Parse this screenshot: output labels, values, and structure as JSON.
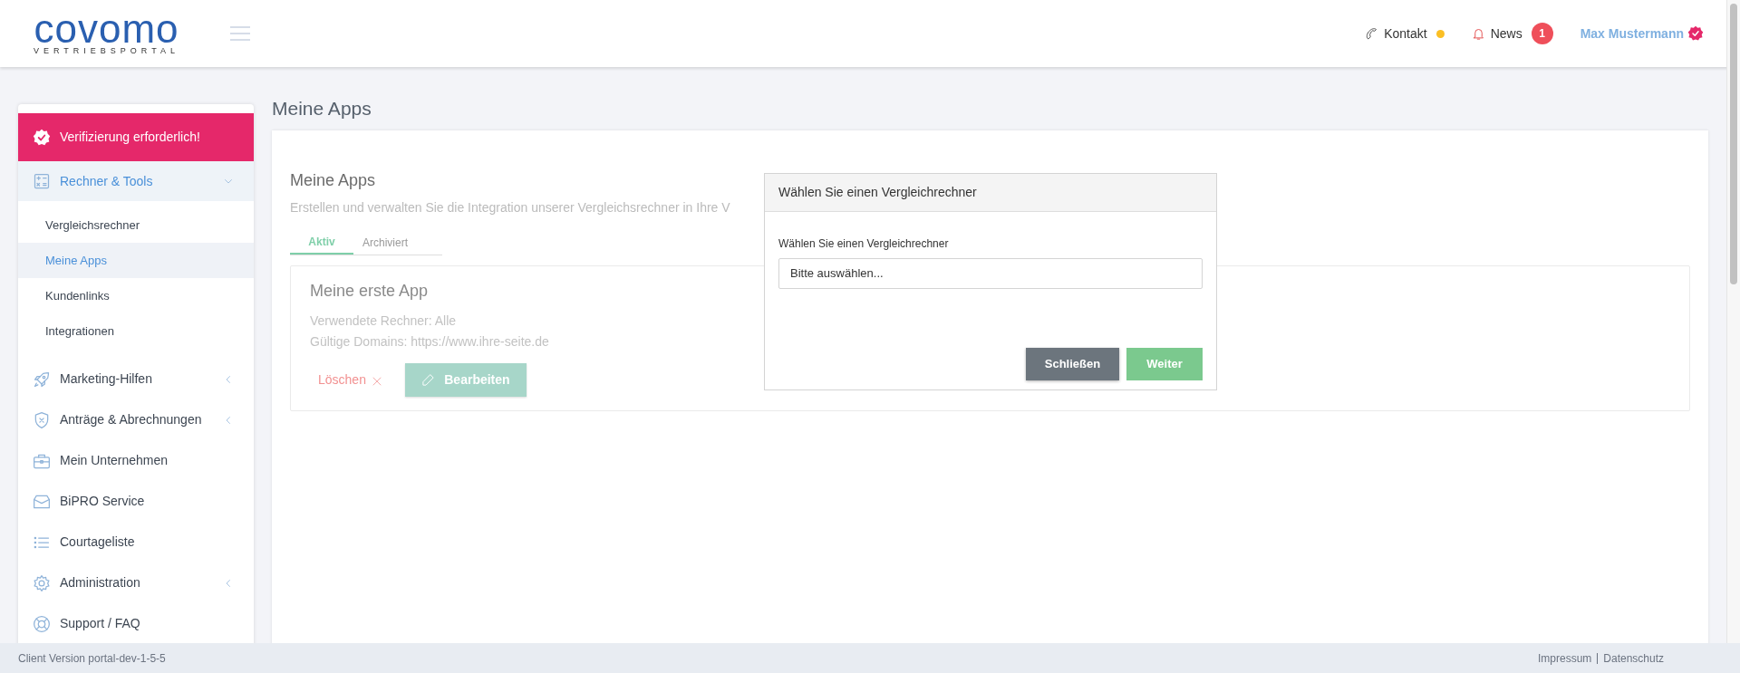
{
  "header": {
    "logo": "covomo",
    "logo_subtitle": "VERTRIEBSPORTAL",
    "contact": {
      "label": "Kontakt",
      "color": "#fbbf24"
    },
    "news": {
      "label": "News",
      "count": "1"
    },
    "user": {
      "name": "Max Mustermann",
      "verified": true
    }
  },
  "sidebar": {
    "banner": "Verifizierung erforderlich!",
    "items": [
      {
        "label": "Rechner & Tools",
        "kind": "group",
        "expanded": true,
        "children": [
          {
            "label": "Vergleichsrechner",
            "selected": false
          },
          {
            "label": "Meine Apps",
            "selected": true
          },
          {
            "label": "Kundenlinks",
            "selected": false
          },
          {
            "label": "Integrationen",
            "selected": false
          }
        ]
      },
      {
        "label": "Marketing-Hilfen",
        "kind": "group",
        "expanded": false
      },
      {
        "label": "Anträge & Abrechnungen",
        "kind": "group",
        "expanded": false
      },
      {
        "label": "Mein Unternehmen",
        "kind": "link"
      },
      {
        "label": "BiPRO Service",
        "kind": "link"
      },
      {
        "label": "Courtageliste",
        "kind": "link"
      },
      {
        "label": "Administration",
        "kind": "group",
        "expanded": false
      },
      {
        "label": "Support / FAQ",
        "kind": "link"
      }
    ]
  },
  "page_title": "Meine Apps",
  "card": {
    "title": "Meine Apps",
    "subtitle": "Erstellen und verwalten Sie die Integration unserer Vergleichsrechner in Ihre V",
    "tabs": [
      {
        "label": "Aktiv",
        "selected": true
      },
      {
        "label": "Archiviert",
        "selected": false
      }
    ],
    "apps": [
      {
        "name": "Meine erste App",
        "lines": [
          "Verwendete Rechner: Alle",
          "Gültige Domains: https://www.ihre-seite.de"
        ],
        "delete_label": "Löschen",
        "edit_label": "Bearbeiten"
      }
    ]
  },
  "modal": {
    "title": "Wählen Sie einen Vergleichrechner",
    "field_label": "Wählen Sie einen Vergleichrechner",
    "select_value": "Bitte auswählen...",
    "buttons": [
      {
        "label": "Schließen",
        "kind": "secondary"
      },
      {
        "label": "Weiter",
        "kind": "primary"
      }
    ]
  },
  "footer": {
    "version": "Client Version portal-dev-1-5-5",
    "links": [
      "Impressum",
      "Datenschutz"
    ]
  }
}
